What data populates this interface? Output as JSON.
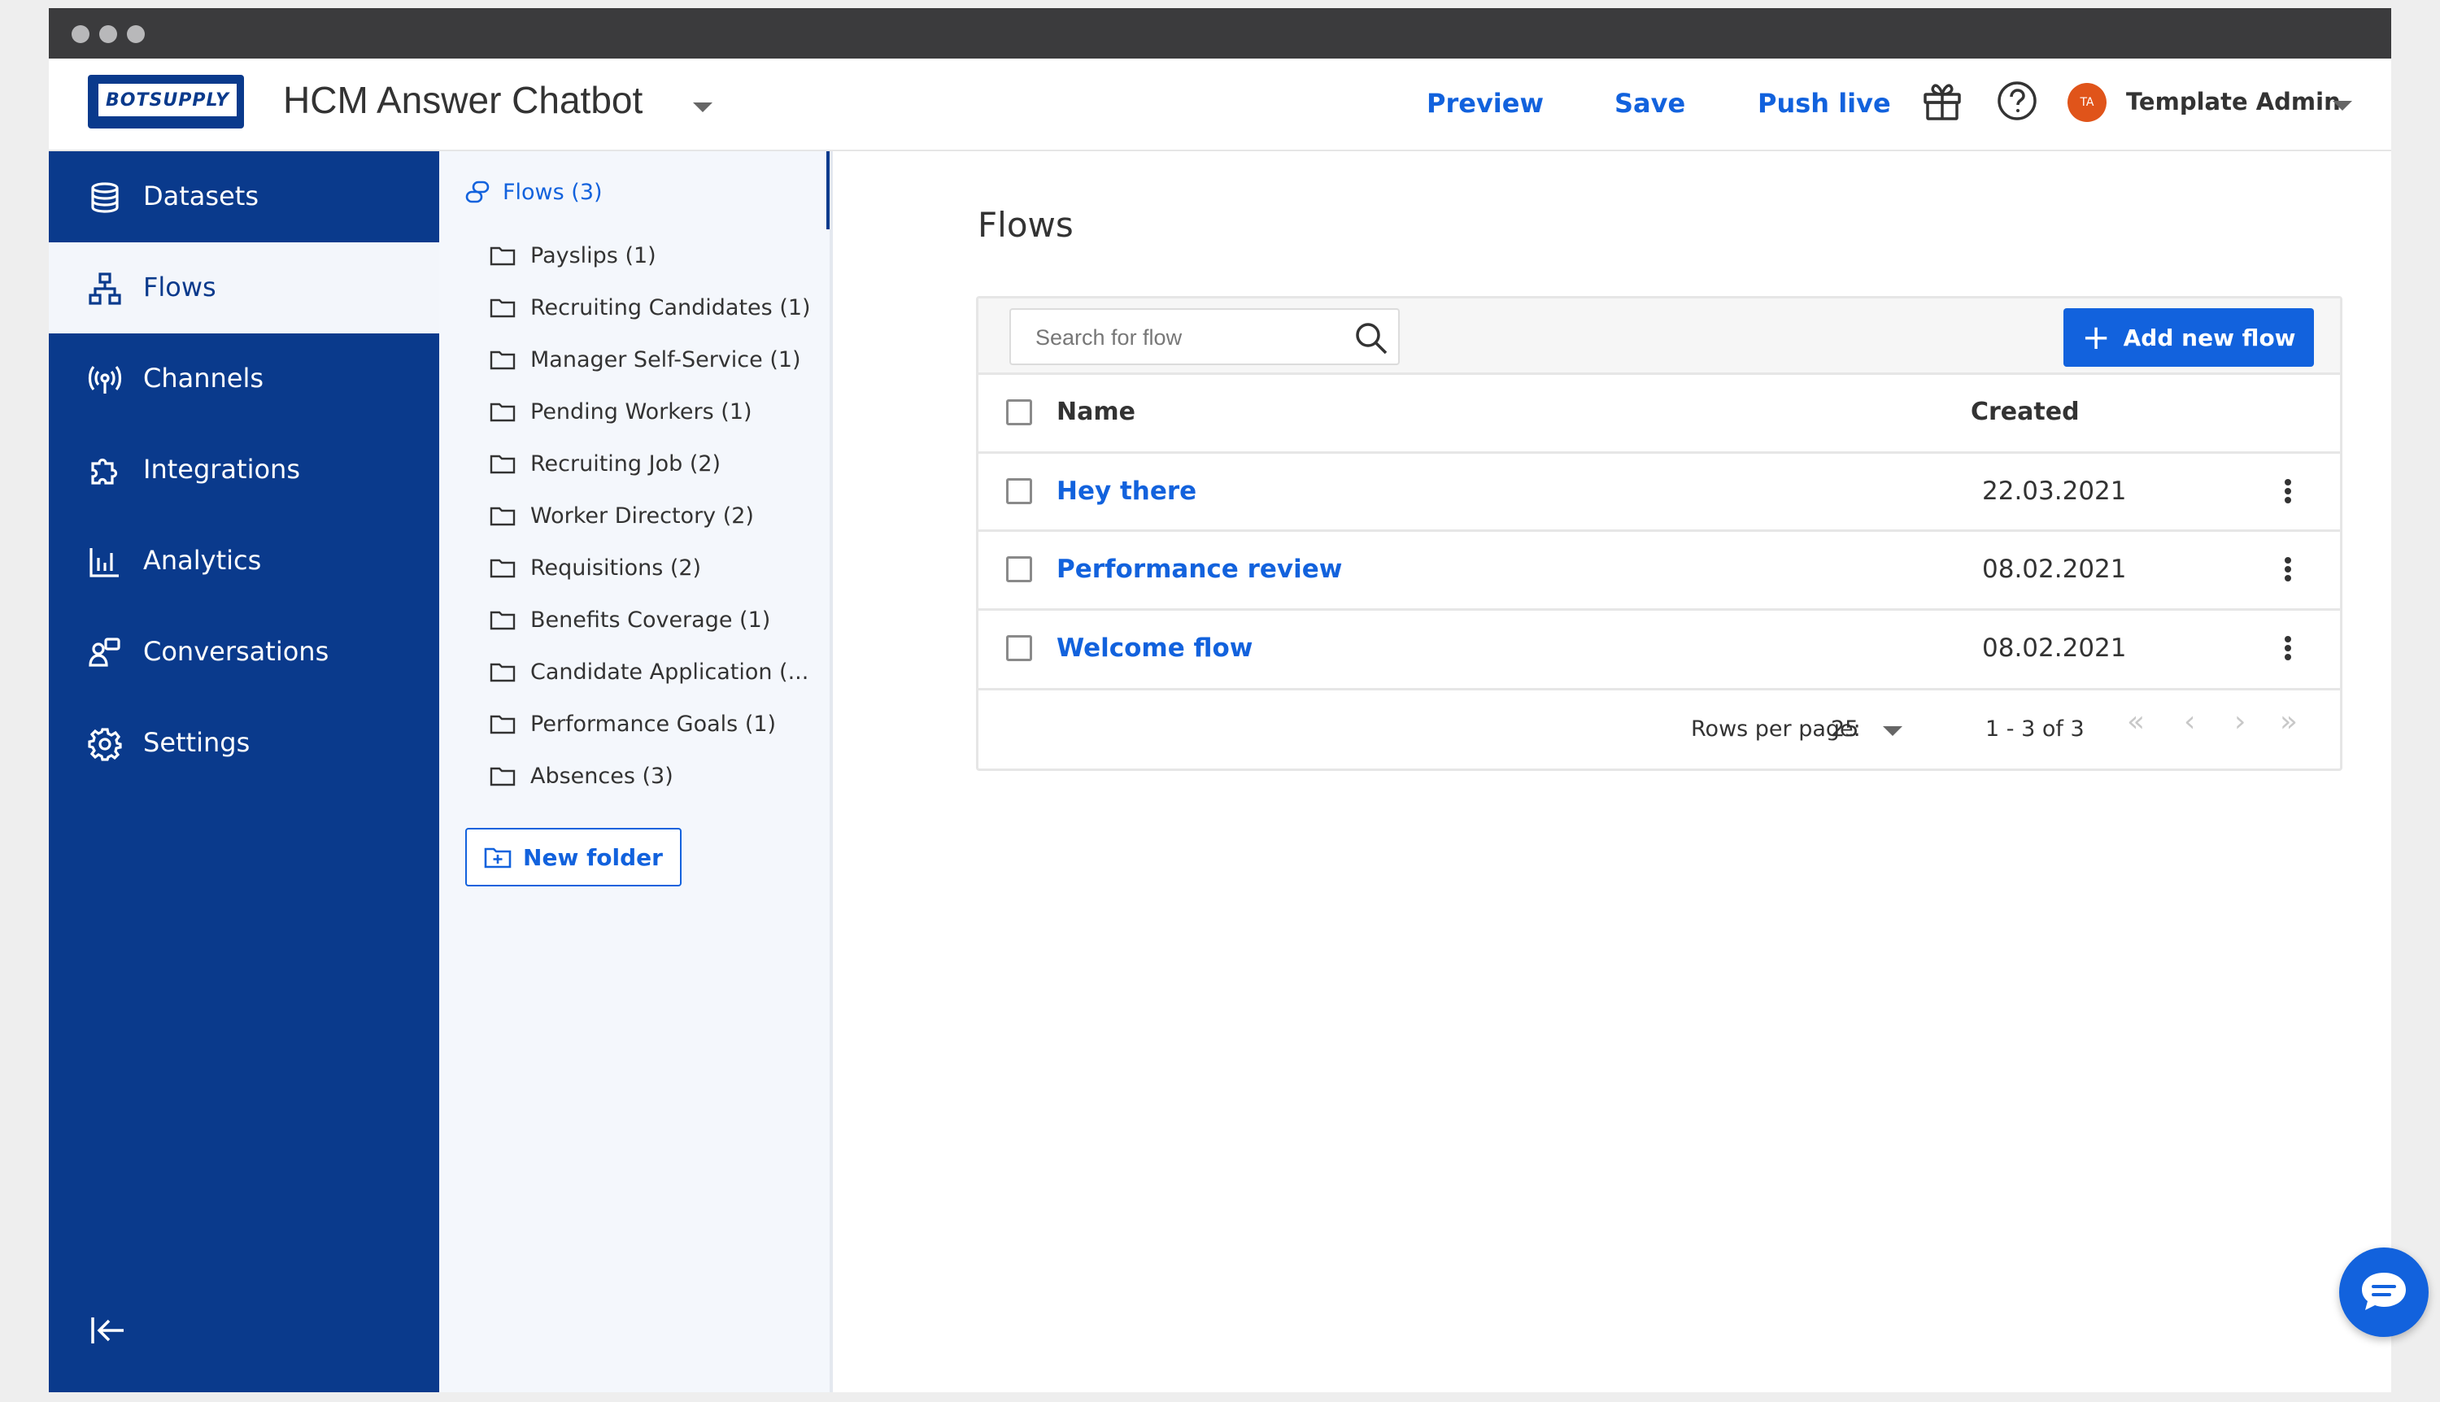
{
  "app": {
    "logo_text": "BOTSUPPLY",
    "title": "HCM Answer Chatbot"
  },
  "topbar": {
    "preview_label": "Preview",
    "save_label": "Save",
    "push_live_label": "Push live",
    "gift_icon": "gift-icon",
    "help_icon": "help-circle-icon",
    "avatar_initials": "TA",
    "avatar_color": "#e0541a",
    "user_name": "Template Admin"
  },
  "sidebar": {
    "items": [
      {
        "label": "Datasets",
        "icon": "database-icon"
      },
      {
        "label": "Flows",
        "icon": "flows-icon",
        "active": true
      },
      {
        "label": "Channels",
        "icon": "broadcast-icon"
      },
      {
        "label": "Integrations",
        "icon": "puzzle-icon"
      },
      {
        "label": "Analytics",
        "icon": "bar-chart-icon"
      },
      {
        "label": "Conversations",
        "icon": "conversations-icon"
      },
      {
        "label": "Settings",
        "icon": "gear-icon"
      }
    ],
    "collapse_icon": "collapse-left-icon"
  },
  "folders": {
    "root_label": "Flows (3)",
    "items": [
      "Payslips (1)",
      "Recruiting Candidates (1)",
      "Manager Self-Service (1)",
      "Pending Workers (1)",
      "Recruiting Job (2)",
      "Worker Directory (2)",
      "Requisitions (2)",
      "Benefits Coverage (1)",
      "Candidate Application (...",
      "Performance Goals (1)",
      "Absences (3)"
    ],
    "new_folder_label": "New folder"
  },
  "main": {
    "page_title": "Flows",
    "search_placeholder": "Search for flow",
    "add_button_label": "Add new flow",
    "columns": {
      "name": "Name",
      "created": "Created"
    },
    "rows": [
      {
        "name": "Hey there",
        "created": "22.03.2021"
      },
      {
        "name": "Performance review",
        "created": "08.02.2021"
      },
      {
        "name": "Welcome flow",
        "created": "08.02.2021"
      }
    ],
    "pagination": {
      "rows_per_page_label": "Rows per page:",
      "rows_per_page_value": "25",
      "range_label": "1 - 3 of 3",
      "first": "«",
      "prev": "‹",
      "next": "›",
      "last": "»"
    }
  },
  "colors": {
    "sidebar_bg": "#0a3a8c",
    "accent_blue": "#1262dd"
  }
}
